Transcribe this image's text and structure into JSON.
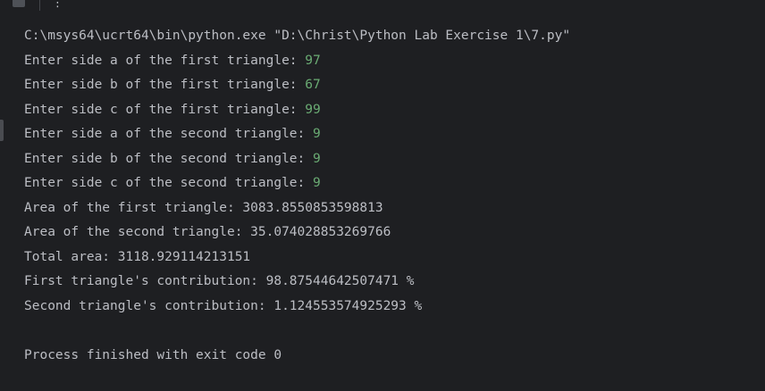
{
  "toolbar": {
    "stop_icon": "stop-icon",
    "more_icon": "more-vertical-icon",
    "more_glyph": "⋮"
  },
  "console": {
    "command": "C:\\msys64\\ucrt64\\bin\\python.exe \"D:\\Christ\\Python Lab Exercise 1\\7.py\"",
    "prompts": [
      {
        "text": "Enter side a of the first triangle: ",
        "input": "97"
      },
      {
        "text": "Enter side b of the first triangle: ",
        "input": "67"
      },
      {
        "text": "Enter side c of the first triangle: ",
        "input": "99"
      },
      {
        "text": "Enter side a of the second triangle: ",
        "input": "9"
      },
      {
        "text": "Enter side b of the second triangle: ",
        "input": "9"
      },
      {
        "text": "Enter side c of the second triangle: ",
        "input": "9"
      }
    ],
    "outputs": [
      "Area of the first triangle: 3083.8550853598813",
      "Area of the second triangle: 35.074028853269766",
      "Total area: 3118.929114213151",
      "First triangle's contribution: 98.87544642507471 %",
      "Second triangle's contribution: 1.124553574925293 %"
    ],
    "exit_message": "Process finished with exit code 0"
  },
  "colors": {
    "background": "#1e1f22",
    "text": "#bcbec4",
    "user_input": "#6aab73"
  }
}
